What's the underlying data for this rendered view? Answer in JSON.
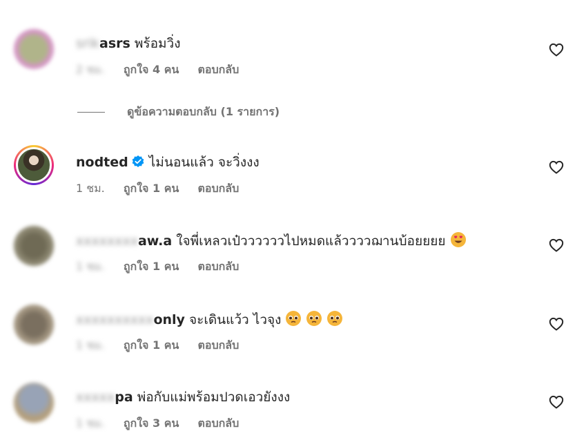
{
  "comments": [
    {
      "username": "srikasrs",
      "username_visible": "asrs",
      "username_blurred": "srik",
      "text": "พร้อมวิ่ง",
      "time": "2 ชม.",
      "likes": "ถูกใจ 4 คน",
      "reply": "ตอบกลับ",
      "avatar_colors": [
        "#b0b48a",
        "#d497c4"
      ]
    },
    {
      "username": "nodted",
      "verified": true,
      "text": "ไม่นอนแล้ว จะวิ่งงง",
      "time": "1 ชม.",
      "likes": "ถูกใจ 1 คน",
      "reply": "ตอบกลับ"
    },
    {
      "username_blurred": "xxxxxxxx",
      "username_visible": "aw.a",
      "text": "ใจพี่เหลวเป๋ววววววไปหมดแล้ววววฌานบ้อยยยย",
      "emoji": "heart-eyes",
      "time": "1 ชม.",
      "likes": "ถูกใจ 1 คน",
      "reply": "ตอบกลับ",
      "avatar_colors": [
        "#6f6a55",
        "#8d8872"
      ]
    },
    {
      "username_blurred": "xxxxxxxxxx",
      "username_visible": "only",
      "text": "จะเดินแว้ว ไวจุง",
      "emoji": "pleading",
      "emoji_count": 3,
      "time": "1 ชม.",
      "likes": "ถูกใจ 1 คน",
      "reply": "ตอบกลับ",
      "avatar_colors": [
        "#7a6f5f",
        "#a49782"
      ]
    },
    {
      "username_blurred": "xxxxx",
      "username_visible": "pa",
      "text": "พ่อกับแม่พร้อมปวดเอวยังงง",
      "time": "1 ชม.",
      "likes": "ถูกใจ 3 คน",
      "reply": "ตอบกลับ",
      "avatar_colors": [
        "#98a3b6",
        "#b39f7e"
      ]
    }
  ],
  "view_replies": "ดูข้อความตอบกลับ (1 รายการ)",
  "colors": {
    "text": "#262626",
    "secondary": "#737373",
    "verified": "#0095f6"
  },
  "icons": {
    "like": "heart-outline-icon",
    "verified": "verified-badge-icon"
  }
}
